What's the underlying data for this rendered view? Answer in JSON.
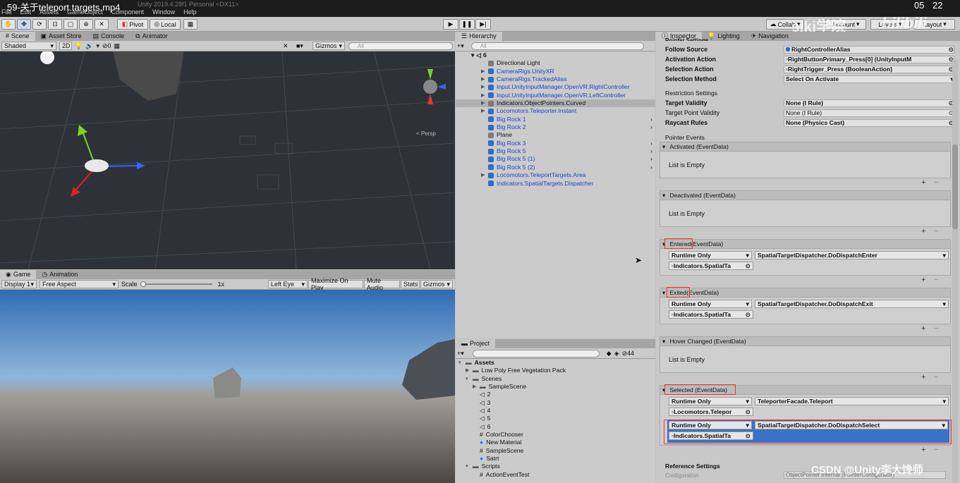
{
  "title": {
    "video_name": "59-关于teleport targets.mp4",
    "app_title": "Unity 2019.4.28f1 Personal <DX11>",
    "time_a": "05",
    "time_b": "22"
  },
  "menu": [
    "File",
    "Edit",
    "Assets",
    "GameObject",
    "Component",
    "Window",
    "Help"
  ],
  "toolbar": {
    "pivot": "Pivot",
    "local": "Local",
    "collab": "Collab",
    "account": "Account",
    "layers": "Layers",
    "layout": "Layout"
  },
  "watermark": {
    "siki": "siki学院",
    "bili": "bilibili",
    "csdn": "CSDN @Unity李大馋师"
  },
  "scene": {
    "tabs": [
      "Scene",
      "Asset Store",
      "Console",
      "Animator"
    ],
    "shading": "Shaded",
    "mode_2d": "2D",
    "hidden_count": "0",
    "gizmos": "Gizmos",
    "search_placeholder": "All",
    "persp": "< Persp"
  },
  "game": {
    "tabs": [
      "Game",
      "Animation"
    ],
    "display": "Display 1",
    "aspect": "Free Aspect",
    "scale_label": "Scale",
    "scale_value": "1x",
    "eye": "Left Eye",
    "maximize": "Maximize On Play",
    "mute": "Mute Audio",
    "stats": "Stats",
    "gizmos": "Gizmos"
  },
  "hierarchy": {
    "tab": "Hierarchy",
    "search_placeholder": "All",
    "scene_name": "6",
    "items": [
      {
        "label": "Directional Light",
        "blue": false,
        "arrow": false
      },
      {
        "label": "CameraRigs.UnityXR",
        "blue": true,
        "arrow": true
      },
      {
        "label": "CameraRigs.TrackedAlias",
        "blue": true,
        "arrow": true
      },
      {
        "label": "Input.UnityInputManager.OpenVR.RightController",
        "blue": true,
        "arrow": true
      },
      {
        "label": "Input.UnityInputManager.OpenVR.LeftController",
        "blue": true,
        "arrow": true
      },
      {
        "label": "Indicators.ObjectPointers.Curved",
        "blue": false,
        "arrow": true,
        "selected": true
      },
      {
        "label": "Locomotors.Teleporter.Instant",
        "blue": true,
        "arrow": true
      },
      {
        "label": "Big Rock 1",
        "blue": true,
        "arrow": false
      },
      {
        "label": "Big Rock 2",
        "blue": true,
        "arrow": false
      },
      {
        "label": "Plane",
        "blue": false,
        "arrow": false
      },
      {
        "label": "Big Rock 3",
        "blue": true,
        "arrow": false
      },
      {
        "label": "Big Rock 5",
        "blue": true,
        "arrow": false
      },
      {
        "label": "Big Rock 5 (1)",
        "blue": true,
        "arrow": false
      },
      {
        "label": "Big Rock 5 (2)",
        "blue": true,
        "arrow": false
      },
      {
        "label": "Locomotors.TeleportTargets.Area",
        "blue": true,
        "arrow": true
      },
      {
        "label": "Indicators.SpatialTargets.Dispatcher",
        "blue": true,
        "arrow": false
      }
    ]
  },
  "project": {
    "tab": "Project",
    "count": "44",
    "items": [
      {
        "label": "Assets",
        "indent": 0,
        "folder": true,
        "open": true,
        "bold": true
      },
      {
        "label": "Low Poly Free Vegetation Pack",
        "indent": 1,
        "folder": true
      },
      {
        "label": "Scenes",
        "indent": 1,
        "folder": true,
        "open": true
      },
      {
        "label": "SampleScene",
        "indent": 2,
        "folder": true
      },
      {
        "label": "2",
        "indent": 2,
        "scene": true
      },
      {
        "label": "3",
        "indent": 2,
        "scene": true
      },
      {
        "label": "4",
        "indent": 2,
        "scene": true
      },
      {
        "label": "5",
        "indent": 2,
        "scene": true
      },
      {
        "label": "6",
        "indent": 2,
        "scene": true
      },
      {
        "label": "ColorChooser",
        "indent": 2
      },
      {
        "label": "New Material",
        "indent": 2,
        "mat": true
      },
      {
        "label": "SampleScene",
        "indent": 2
      },
      {
        "label": "Satrt",
        "indent": 2,
        "mat": true
      },
      {
        "label": "Scripts",
        "indent": 1,
        "folder": true,
        "open": true
      },
      {
        "label": "ActionEventTest",
        "indent": 2
      }
    ]
  },
  "inspector": {
    "tabs": [
      "Inspector",
      "Lighting",
      "Navigation"
    ],
    "cut_label": "Pointer Settings",
    "fields": [
      {
        "label": "Follow Source",
        "value": "RightControllerAlias"
      },
      {
        "label": "Activation Action",
        "value": "RightButtonPrimary_Press[0] (UnityInputM"
      },
      {
        "label": "Selection Action",
        "value": "RightTrigger_Press (BooleanAction)"
      },
      {
        "label": "Selection Method",
        "value": "Select On Activate"
      }
    ],
    "restriction_title": "Restriction Settings",
    "restriction": [
      {
        "label": "Target Validity",
        "value": "None (I Rule)"
      },
      {
        "label": "Target Point Validity",
        "value": "None (I Rule)"
      },
      {
        "label": "Raycast Rules",
        "value": "None (Physics Cast)"
      }
    ],
    "pointer_events_title": "Pointer Events",
    "events": {
      "activated": {
        "header": "Activated (EventData)",
        "empty": "List is Empty"
      },
      "deactivated": {
        "header": "Deactivated (EventData)",
        "empty": "List is Empty"
      },
      "entered": {
        "name": "Entered",
        "suffix": " (EventData)",
        "mode": "Runtime Only",
        "func": "SpatialTargetDispatcher.DoDispatchEnter",
        "obj": "Indicators.SpatialTa"
      },
      "exited": {
        "name": "Exited",
        "suffix": " (EventData)",
        "mode": "Runtime Only",
        "func": "SpatialTargetDispatcher.DoDispatchExit",
        "obj": "Indicators.SpatialTa"
      },
      "hover": {
        "header": "Hover Changed (EventData)",
        "empty": "List is Empty"
      },
      "selected": {
        "header": "Selected (EventData)",
        "l1_mode": "Runtime Only",
        "l1_func": "TeleporterFacade.Teleport",
        "l1_obj": "Locomotors.Telepor",
        "l2_mode": "Runtime Only",
        "l2_func": "SpatialTargetDispatcher.DoDispatchSelect",
        "l2_obj": "Indicators.SpatialTa"
      }
    },
    "reference_title": "Reference Settings",
    "configuration": "Configuration",
    "config_value": "ObjectPointer.Internal (PointerConfigurator)"
  }
}
